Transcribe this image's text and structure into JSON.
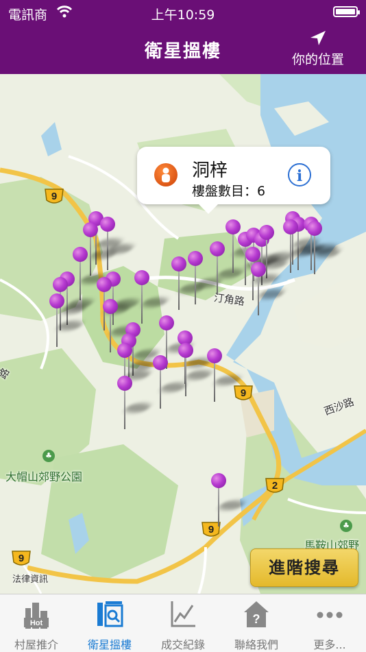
{
  "status_bar": {
    "carrier": "電訊商",
    "time": "上午10:59"
  },
  "nav": {
    "title": "衛星搵樓",
    "location_label": "你的位置"
  },
  "map": {
    "labels": {
      "road_ding_kok": "汀角路",
      "road_sai_sha": "西沙路",
      "park_tai_mo_shan": "大帽山郊野公園",
      "park_ma_on_shan": "馬鞍山郊野",
      "legal_info": "法律資訊",
      "road_partial": "路"
    },
    "route_shields": [
      "9",
      "9",
      "9",
      "2",
      "9"
    ]
  },
  "callout": {
    "name": "洞梓",
    "count_text": "樓盤數目：6"
  },
  "advanced_search_label": "進階搜尋",
  "tabs": [
    {
      "label": "村屋推介",
      "icon": "hot-buildings-icon",
      "badge": "Hot"
    },
    {
      "label": "衛星搵樓",
      "icon": "satellite-search-icon",
      "active": true
    },
    {
      "label": "成交紀錄",
      "icon": "line-chart-icon"
    },
    {
      "label": "聯絡我們",
      "icon": "contact-house-icon"
    },
    {
      "label": "更多...",
      "icon": "more-dots-icon"
    }
  ],
  "colors": {
    "nav_bg": "#6a0f76",
    "pin": "#b63ad0",
    "tab_active": "#1a7bd3",
    "button_gold": "#e4b92b"
  }
}
